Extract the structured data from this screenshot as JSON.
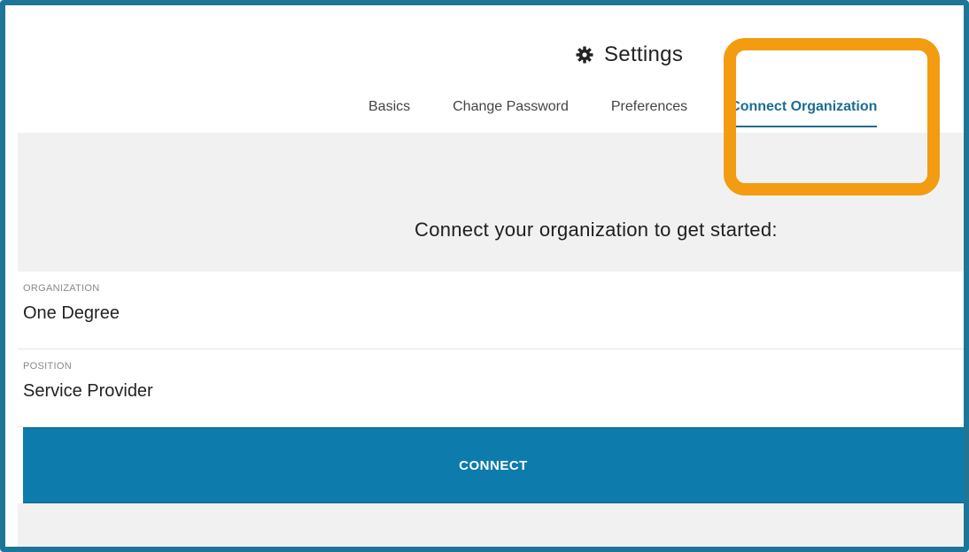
{
  "header": {
    "title": "Settings",
    "title_icon": "gear-icon"
  },
  "tabs": [
    {
      "label": "Basics",
      "active": false
    },
    {
      "label": "Change Password",
      "active": false
    },
    {
      "label": "Preferences",
      "active": false
    },
    {
      "label": "Connect Organization",
      "active": true
    }
  ],
  "main": {
    "heading": "Connect your organization to get started:"
  },
  "form": {
    "organization": {
      "label": "ORGANIZATION",
      "value": "One Degree"
    },
    "position": {
      "label": "POSITION",
      "value": "Service Provider"
    },
    "connect_label": "CONNECT"
  },
  "colors": {
    "accent": "#0e7bad",
    "highlight": "#f39c12",
    "frame": "#1d7698"
  }
}
